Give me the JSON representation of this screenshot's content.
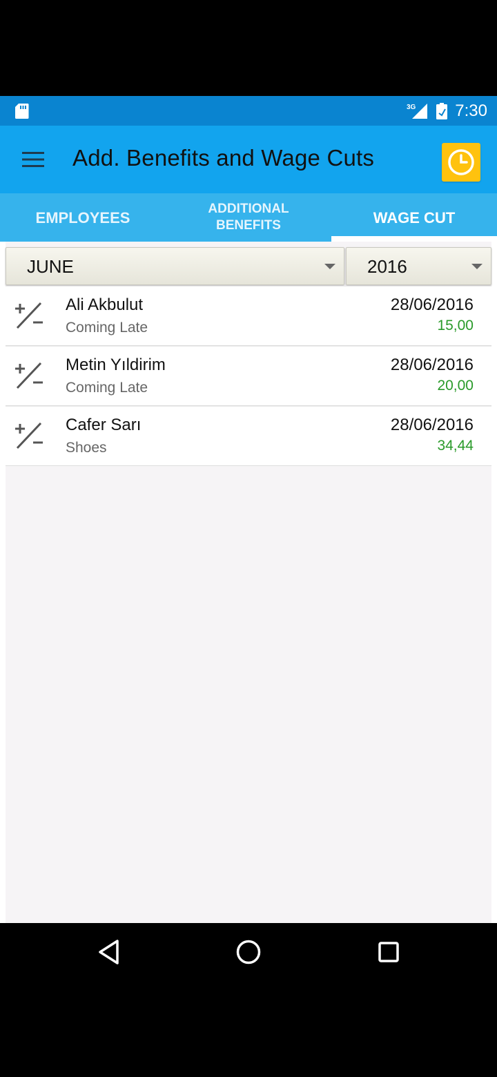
{
  "status_bar": {
    "network": "3G",
    "time": "7:30",
    "icons": [
      "sd-card-icon",
      "signal-icon",
      "battery-icon"
    ]
  },
  "app_bar": {
    "title": "Add. Benefits and Wage Cuts",
    "menu_icon": "menu-icon",
    "action_icon": "clock-icon",
    "action_color": "#ffc20e"
  },
  "tabs": [
    {
      "label": "EMPLOYEES",
      "selected": false
    },
    {
      "label_line1": "ADDITIONAL",
      "label_line2": "BENEFITS",
      "selected": false
    },
    {
      "label": "WAGE CUT",
      "selected": true
    }
  ],
  "filters": {
    "month": "JUNE",
    "year": "2016"
  },
  "wage_cuts": [
    {
      "name": "Ali Akbulut",
      "reason": "Coming Late",
      "date": "28/06/2016",
      "amount": "15,00"
    },
    {
      "name": "Metin Yıldirim",
      "reason": "Coming Late",
      "date": "28/06/2016",
      "amount": "20,00"
    },
    {
      "name": "Cafer Sarı",
      "reason": "Shoes",
      "date": "28/06/2016",
      "amount": "34,44"
    }
  ],
  "colors": {
    "status_bar": "#0a84d0",
    "app_bar": "#12a4ee",
    "tab_bar": "#36b3ec",
    "amount": "#2a9a2a"
  },
  "nav_bar": [
    "back-icon",
    "home-icon",
    "recents-icon"
  ]
}
